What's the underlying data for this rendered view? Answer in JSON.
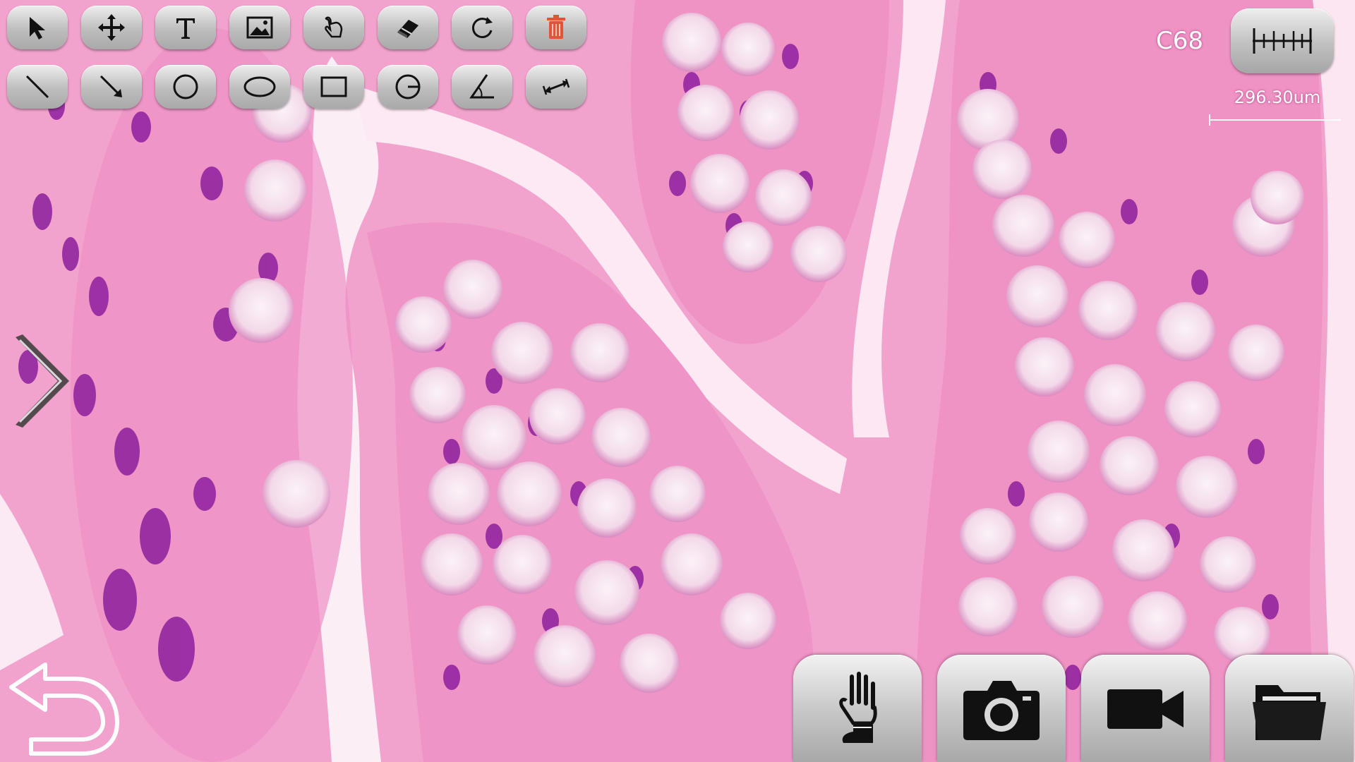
{
  "viewer": {
    "magnification": "C68",
    "scale_label": "296.30um"
  },
  "toolbar": {
    "row1": [
      "select-arrow-icon",
      "move-icon",
      "text-icon",
      "image-icon",
      "freehand-draw-icon",
      "eraser-icon",
      "rotate-icon",
      "trash-icon"
    ],
    "row2": [
      "line-icon",
      "arrow-line-icon",
      "circle-icon",
      "ellipse-icon",
      "rectangle-icon",
      "circle-radius-icon",
      "angle-icon",
      "measure-distance-icon"
    ]
  },
  "bottom_bar": [
    "hand-pan-icon",
    "camera-icon",
    "video-camera-icon",
    "folder-icon"
  ],
  "colors": {
    "tissue_pink": "#f3a6cf",
    "nuclei_purple": "#8a1f9a",
    "goblet_white": "#f7ecf3",
    "button_gray": "#bdbdbd",
    "trash_red": "#e0553a"
  }
}
